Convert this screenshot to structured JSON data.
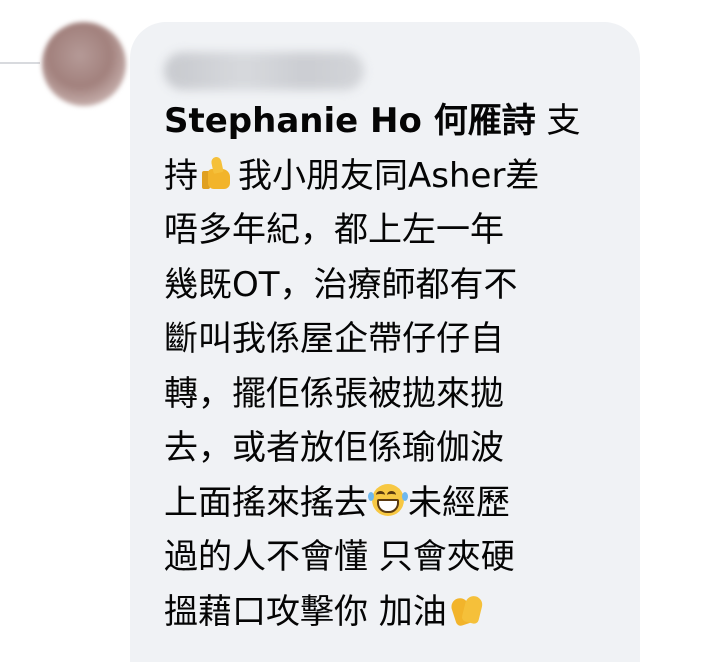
{
  "comment": {
    "author_name": "Stephanie Ho 何雁詩",
    "text_lines": [
      "支",
      "持",
      "我小朋友同Asher差",
      "唔多年紀，都上左一年",
      "幾既OT，治療師都有不",
      "斷叫我係屋企帶仔仔自",
      "轉，擺佢係張被拋來拋",
      "去，或者放佢係瑜伽波",
      "上面搖來搖去",
      "未經歷",
      "過的人不會懂 只會夾硬",
      "搵藉口攻擊你 加油"
    ],
    "emojis": [
      "thumbs-up-emoji",
      "laughing-tears-emoji",
      "clapping-hands-emoji"
    ]
  },
  "colors": {
    "bubble_background": "#f0f2f5",
    "text": "#050505",
    "page_background": "#ffffff"
  }
}
